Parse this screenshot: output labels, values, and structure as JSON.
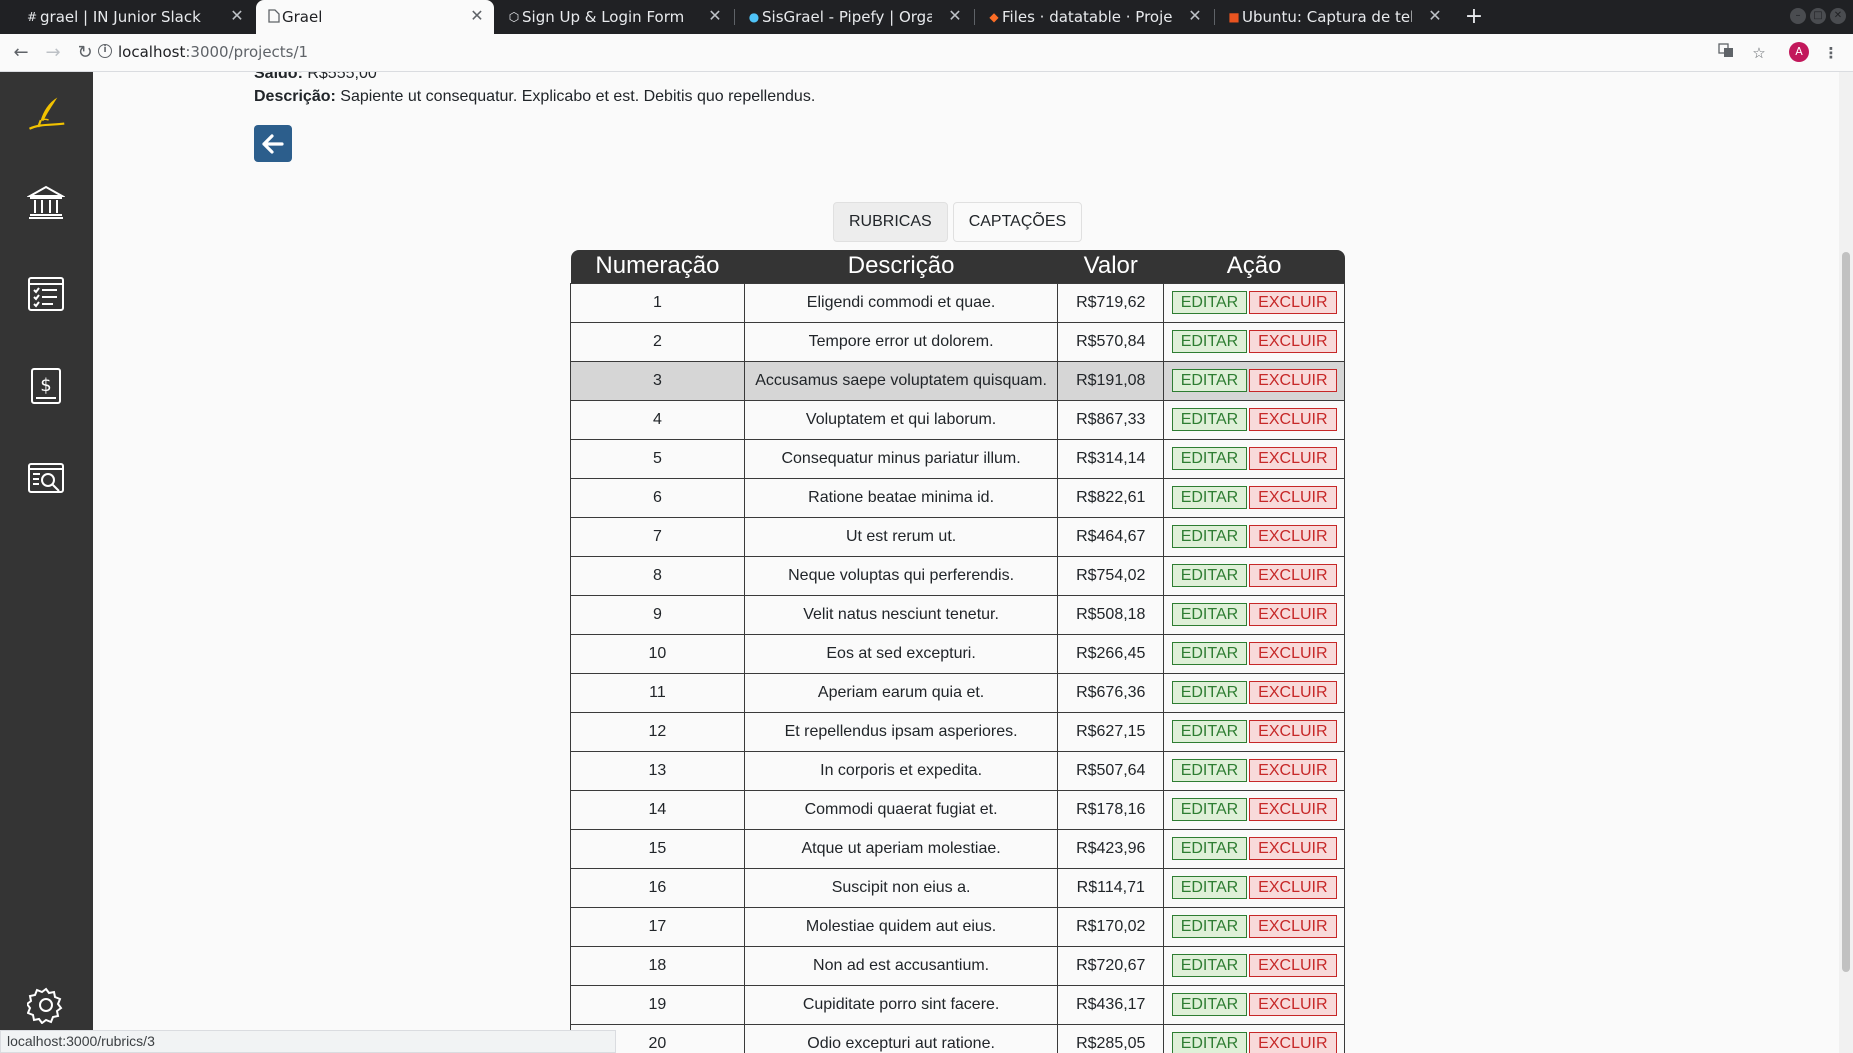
{
  "browser": {
    "tabs": [
      {
        "title": "grael | IN Junior Slack",
        "icon": "slack-hash-icon"
      },
      {
        "title": "Grael",
        "icon": "page-icon",
        "active": true
      },
      {
        "title": "Sign Up & Login Form",
        "icon": "codepen-icon"
      },
      {
        "title": "SisGrael - Pipefy | Organiz",
        "icon": "pipefy-icon"
      },
      {
        "title": "Files · datatable · Projetos",
        "icon": "gitlab-icon"
      },
      {
        "title": "Ubuntu: Captura de tela",
        "icon": "ubuntu-icon"
      }
    ],
    "url_host": "localhost",
    "url_path": ":3000/projects/1",
    "avatar_letter": "A",
    "status_url": "localhost:3000/rubrics/3"
  },
  "project": {
    "saldo_label": "Saldo:",
    "saldo_value": "R$555,00",
    "descricao_label": "Descrição:",
    "descricao_value": "Sapiente ut consequatur. Explicabo et est. Debitis quo repellendus."
  },
  "tabs": {
    "rubricas": "RUBRICAS",
    "captacoes": "CAPTAÇÕES"
  },
  "table": {
    "headers": [
      "Numeração",
      "Descrição",
      "Valor",
      "Ação"
    ],
    "edit_label": "EDITAR",
    "delete_label": "EXCLUIR",
    "highlighted_row": 3,
    "rows": [
      {
        "num": "1",
        "desc": "Eligendi commodi et quae.",
        "valor": "R$719,62"
      },
      {
        "num": "2",
        "desc": "Tempore error ut dolorem.",
        "valor": "R$570,84"
      },
      {
        "num": "3",
        "desc": "Accusamus saepe voluptatem quisquam.",
        "valor": "R$191,08"
      },
      {
        "num": "4",
        "desc": "Voluptatem et qui laborum.",
        "valor": "R$867,33"
      },
      {
        "num": "5",
        "desc": "Consequatur minus pariatur illum.",
        "valor": "R$314,14"
      },
      {
        "num": "6",
        "desc": "Ratione beatae minima id.",
        "valor": "R$822,61"
      },
      {
        "num": "7",
        "desc": "Ut est rerum ut.",
        "valor": "R$464,67"
      },
      {
        "num": "8",
        "desc": "Neque voluptas qui perferendis.",
        "valor": "R$754,02"
      },
      {
        "num": "9",
        "desc": "Velit natus nesciunt tenetur.",
        "valor": "R$508,18"
      },
      {
        "num": "10",
        "desc": "Eos at sed excepturi.",
        "valor": "R$266,45"
      },
      {
        "num": "11",
        "desc": "Aperiam earum quia et.",
        "valor": "R$676,36"
      },
      {
        "num": "12",
        "desc": "Et repellendus ipsam asperiores.",
        "valor": "R$627,15"
      },
      {
        "num": "13",
        "desc": "In corporis et expedita.",
        "valor": "R$507,64"
      },
      {
        "num": "14",
        "desc": "Commodi quaerat fugiat et.",
        "valor": "R$178,16"
      },
      {
        "num": "15",
        "desc": "Atque ut aperiam molestiae.",
        "valor": "R$423,96"
      },
      {
        "num": "16",
        "desc": "Suscipit non eius a.",
        "valor": "R$114,71"
      },
      {
        "num": "17",
        "desc": "Molestiae quidem aut eius.",
        "valor": "R$170,02"
      },
      {
        "num": "18",
        "desc": "Non ad est accusantium.",
        "valor": "R$720,67"
      },
      {
        "num": "19",
        "desc": "Cupiditate porro sint facere.",
        "valor": "R$436,17"
      },
      {
        "num": "20",
        "desc": "Odio excepturi aut ratione.",
        "valor": "R$285,05"
      }
    ]
  },
  "sidebar": {
    "items": [
      {
        "icon": "quill-logo-icon"
      },
      {
        "icon": "bank-icon"
      },
      {
        "icon": "checklist-icon"
      },
      {
        "icon": "money-document-icon"
      },
      {
        "icon": "report-search-icon"
      },
      {
        "icon": "gear-icon"
      }
    ]
  },
  "colors": {
    "sidebar_bg": "#343434",
    "logo_accent": "#f2c200",
    "back_button": "#2c5e8c",
    "edit_green": "#2e7d32",
    "delete_red": "#c62828"
  }
}
